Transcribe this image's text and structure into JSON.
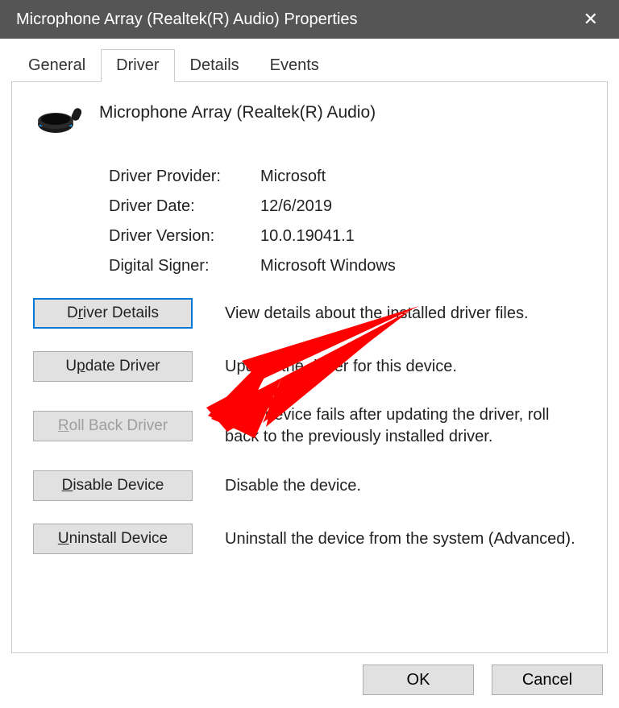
{
  "window": {
    "title": "Microphone Array (Realtek(R) Audio) Properties"
  },
  "tabs": {
    "general": "General",
    "driver": "Driver",
    "details": "Details",
    "events": "Events"
  },
  "device": {
    "name": "Microphone Array (Realtek(R) Audio)"
  },
  "info": {
    "provider_label": "Driver Provider:",
    "provider_value": "Microsoft",
    "date_label": "Driver Date:",
    "date_value": "12/6/2019",
    "version_label": "Driver Version:",
    "version_value": "10.0.19041.1",
    "signer_label": "Digital Signer:",
    "signer_value": "Microsoft Windows"
  },
  "actions": {
    "details": {
      "label_pre": "D",
      "label_ul": "r",
      "label_post": "iver Details",
      "desc": "View details about the installed driver files."
    },
    "update": {
      "label_pre": "U",
      "label_ul": "p",
      "label_post": "date Driver",
      "desc": "Update the driver for this device."
    },
    "rollback": {
      "label_pre": "",
      "label_ul": "R",
      "label_post": "oll Back Driver",
      "desc": "If the device fails after updating the driver, roll back to the previously installed driver."
    },
    "disable": {
      "label_pre": "",
      "label_ul": "D",
      "label_post": "isable Device",
      "desc": "Disable the device."
    },
    "uninstall": {
      "label_pre": "",
      "label_ul": "U",
      "label_post": "ninstall Device",
      "desc": "Uninstall the device from the system (Advanced)."
    }
  },
  "footer": {
    "ok": "OK",
    "cancel": "Cancel"
  }
}
